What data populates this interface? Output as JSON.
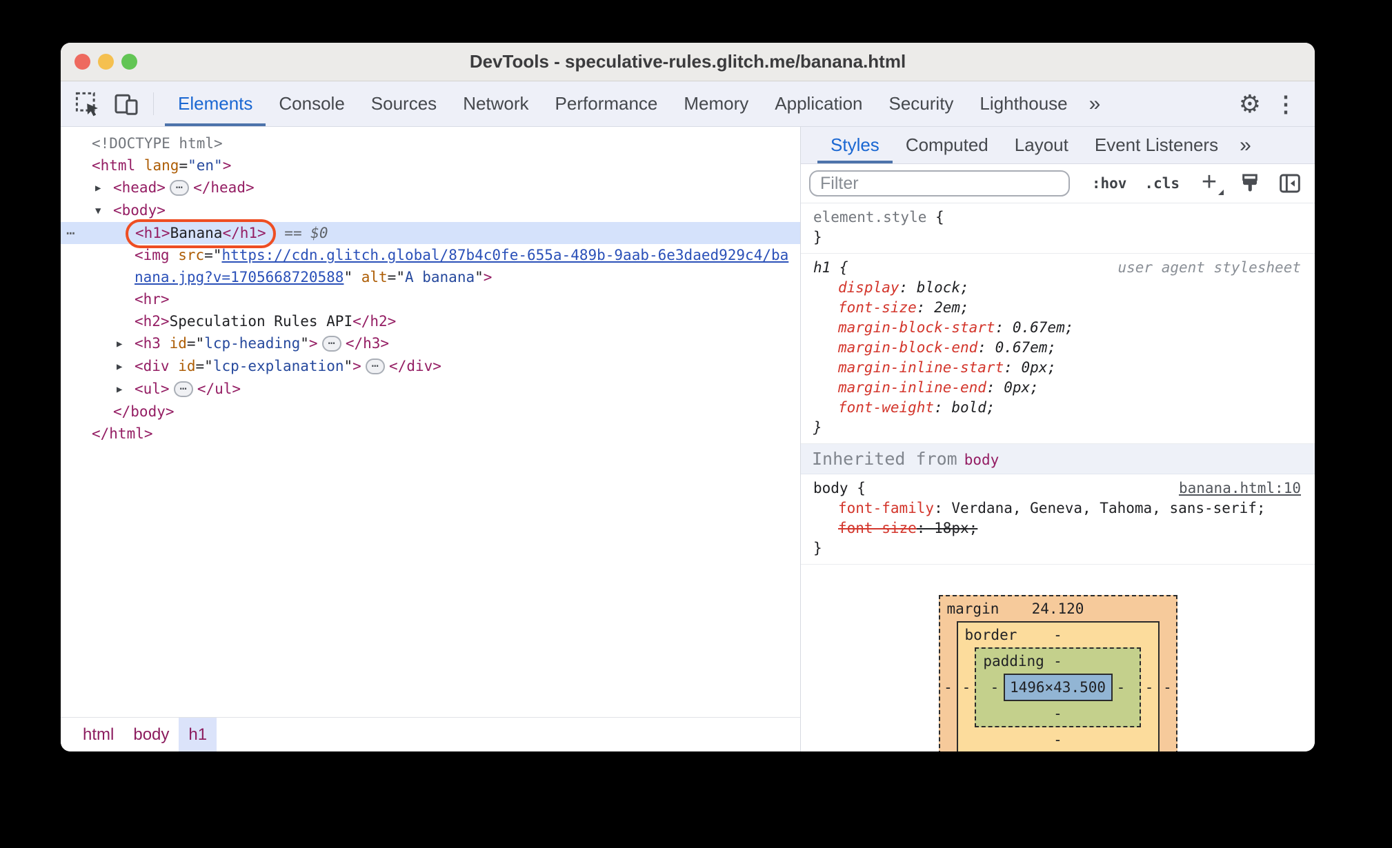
{
  "window": {
    "title": "DevTools - speculative-rules.glitch.me/banana.html"
  },
  "colors": {
    "accent_blue": "#1a67d2",
    "callout_orange": "#ee4e23",
    "selection_blue": "#d5e2fb"
  },
  "main_tabs": [
    {
      "label": "Elements",
      "selected": true
    },
    {
      "label": "Console"
    },
    {
      "label": "Sources"
    },
    {
      "label": "Network"
    },
    {
      "label": "Performance"
    },
    {
      "label": "Memory"
    },
    {
      "label": "Application"
    },
    {
      "label": "Security"
    },
    {
      "label": "Lighthouse"
    }
  ],
  "icons": {
    "overflow_chevron": "»",
    "gear": "⚙",
    "menu_dots": "⋮",
    "new_rule_plus": "+"
  },
  "side_tabs": [
    {
      "label": "Styles",
      "selected": true
    },
    {
      "label": "Computed"
    },
    {
      "label": "Layout"
    },
    {
      "label": "Event Listeners"
    }
  ],
  "styles_toolbar": {
    "filter_placeholder": "Filter",
    "hov": ":hov",
    "cls": ".cls"
  },
  "tree": {
    "lines": [
      {
        "ind": 0,
        "parts": [
          {
            "c": "gray",
            "t": "<!DOCTYPE html>"
          }
        ]
      },
      {
        "ind": 0,
        "parts": [
          {
            "c": "tag",
            "t": "<html"
          },
          {
            "c": "txt",
            "t": " "
          },
          {
            "c": "attr",
            "t": "lang"
          },
          {
            "c": "txt",
            "t": "="
          },
          {
            "c": "val",
            "t": "\"en\""
          },
          {
            "c": "tag",
            "t": ">"
          }
        ]
      },
      {
        "ind": 1,
        "parts": [
          {
            "c": "arrow",
            "t": "▶"
          },
          {
            "c": "tag",
            "t": "<head>"
          },
          {
            "c": "pill",
            "t": "⋯"
          },
          {
            "c": "tag",
            "t": "</head>"
          }
        ]
      },
      {
        "ind": 1,
        "parts": [
          {
            "c": "arrow",
            "t": "▼"
          },
          {
            "c": "tag",
            "t": "<body>"
          }
        ]
      },
      {
        "ind": 2,
        "cls": "selected",
        "parts": [
          {
            "c": "rowmenu",
            "t": "⋯"
          },
          {
            "c": "callout",
            "group": [
              {
                "c": "tag",
                "t": "<h1>"
              },
              {
                "c": "txt",
                "t": "Banana"
              },
              {
                "c": "tag",
                "t": "</h1>"
              }
            ]
          },
          {
            "c": "eq",
            "t": " == $0"
          }
        ]
      },
      {
        "ind": 2,
        "parts": [
          {
            "c": "tag",
            "t": "<img"
          },
          {
            "c": "txt",
            "t": " "
          },
          {
            "c": "attr",
            "t": "src"
          },
          {
            "c": "txt",
            "t": "=\""
          },
          {
            "c": "link",
            "t": "https://cdn.glitch.global/87b4c0fe-655a-489b-9aab-6e3daed929c4/ba"
          }
        ]
      },
      {
        "ind": 2,
        "parts": [
          {
            "c": "link",
            "t": "nana.jpg?v=1705668720588"
          },
          {
            "c": "txt",
            "t": "\" "
          },
          {
            "c": "attr",
            "t": "alt"
          },
          {
            "c": "txt",
            "t": "=\""
          },
          {
            "c": "val",
            "t": "A banana"
          },
          {
            "c": "txt",
            "t": "\""
          },
          {
            "c": "tag",
            "t": ">"
          }
        ]
      },
      {
        "ind": 2,
        "parts": [
          {
            "c": "tag",
            "t": "<hr>"
          }
        ]
      },
      {
        "ind": 2,
        "parts": [
          {
            "c": "tag",
            "t": "<h2>"
          },
          {
            "c": "txt",
            "t": "Speculation Rules API"
          },
          {
            "c": "tag",
            "t": "</h2>"
          }
        ]
      },
      {
        "ind": 2,
        "parts": [
          {
            "c": "arrow",
            "t": "▶"
          },
          {
            "c": "tag",
            "t": "<h3"
          },
          {
            "c": "txt",
            "t": " "
          },
          {
            "c": "attr",
            "t": "id"
          },
          {
            "c": "txt",
            "t": "=\""
          },
          {
            "c": "val",
            "t": "lcp-heading"
          },
          {
            "c": "txt",
            "t": "\""
          },
          {
            "c": "tag",
            "t": ">"
          },
          {
            "c": "pill",
            "t": "⋯"
          },
          {
            "c": "tag",
            "t": "</h3>"
          }
        ]
      },
      {
        "ind": 2,
        "parts": [
          {
            "c": "arrow",
            "t": "▶"
          },
          {
            "c": "tag",
            "t": "<div"
          },
          {
            "c": "txt",
            "t": " "
          },
          {
            "c": "attr",
            "t": "id"
          },
          {
            "c": "txt",
            "t": "=\""
          },
          {
            "c": "val",
            "t": "lcp-explanation"
          },
          {
            "c": "txt",
            "t": "\""
          },
          {
            "c": "tag",
            "t": ">"
          },
          {
            "c": "pill",
            "t": "⋯"
          },
          {
            "c": "tag",
            "t": "</div>"
          }
        ]
      },
      {
        "ind": 2,
        "parts": [
          {
            "c": "arrow",
            "t": "▶"
          },
          {
            "c": "tag",
            "t": "<ul>"
          },
          {
            "c": "pill",
            "t": "⋯"
          },
          {
            "c": "tag",
            "t": "</ul>"
          }
        ]
      },
      {
        "ind": 1,
        "parts": [
          {
            "c": "tag",
            "t": "</body>"
          }
        ]
      },
      {
        "ind": 0,
        "parts": [
          {
            "c": "tag",
            "t": "</html>"
          }
        ]
      }
    ]
  },
  "styles": {
    "rule_element": {
      "lines": [
        {
          "parts": [
            {
              "c": "gray",
              "t": "element.style"
            },
            {
              "c": "txt",
              "t": " {"
            }
          ]
        },
        {
          "parts": [
            {
              "c": "txt",
              "t": "}"
            }
          ]
        }
      ]
    },
    "rule_h1": {
      "lines": [
        {
          "parts": [
            {
              "c": "origin",
              "t": "user agent stylesheet"
            },
            {
              "c": "txt",
              "t": "h1 {"
            }
          ]
        },
        {
          "cls": "d",
          "parts": [
            {
              "c": "prop",
              "t": "display"
            },
            {
              "c": "txt",
              "t": ": block;"
            }
          ]
        },
        {
          "cls": "d",
          "parts": [
            {
              "c": "prop",
              "t": "font-size"
            },
            {
              "c": "txt",
              "t": ": 2em;"
            }
          ]
        },
        {
          "cls": "d",
          "parts": [
            {
              "c": "prop",
              "t": "margin-block-start"
            },
            {
              "c": "txt",
              "t": ": 0.67em;"
            }
          ]
        },
        {
          "cls": "d",
          "parts": [
            {
              "c": "prop",
              "t": "margin-block-end"
            },
            {
              "c": "txt",
              "t": ": 0.67em;"
            }
          ]
        },
        {
          "cls": "d",
          "parts": [
            {
              "c": "prop",
              "t": "margin-inline-start"
            },
            {
              "c": "txt",
              "t": ": 0px;"
            }
          ]
        },
        {
          "cls": "d",
          "parts": [
            {
              "c": "prop",
              "t": "margin-inline-end"
            },
            {
              "c": "txt",
              "t": ": 0px;"
            }
          ]
        },
        {
          "cls": "d",
          "parts": [
            {
              "c": "prop",
              "t": "font-weight"
            },
            {
              "c": "txt",
              "t": ": bold;"
            }
          ]
        },
        {
          "parts": [
            {
              "c": "txt",
              "t": "}"
            }
          ]
        }
      ]
    },
    "inherited": {
      "prefix": "Inherited from",
      "from": "body"
    },
    "rule_body": {
      "lines": [
        {
          "parts": [
            {
              "c": "originlink",
              "t": "banana.html:10"
            },
            {
              "c": "txt",
              "t": "body {"
            }
          ]
        },
        {
          "cls": "d",
          "parts": [
            {
              "c": "prop",
              "t": "font-family"
            },
            {
              "c": "txt",
              "t": ": Verdana, Geneva, Tahoma, sans-serif;"
            }
          ]
        },
        {
          "cls": "d struck",
          "parts": [
            {
              "c": "prop",
              "t": "font-size"
            },
            {
              "c": "txt",
              "t": ": 18px;"
            }
          ]
        },
        {
          "parts": [
            {
              "c": "txt",
              "t": "}"
            }
          ]
        }
      ]
    }
  },
  "box_model": {
    "margin_label": "margin",
    "margin_top": "24.120",
    "margin_left": "-",
    "margin_right": "-",
    "border_label": "border",
    "border_top": "-",
    "border_left": "-",
    "border_right": "-",
    "border_bottom": "-",
    "padding_label": "padding",
    "padding_top": "-",
    "padding_left": "-",
    "padding_right": "-",
    "padding_bottom": "-",
    "content": "1496×43.500"
  },
  "crumbs": {
    "items": [
      {
        "label": "html"
      },
      {
        "label": "body"
      },
      {
        "label": "h1",
        "selected": true
      }
    ]
  }
}
